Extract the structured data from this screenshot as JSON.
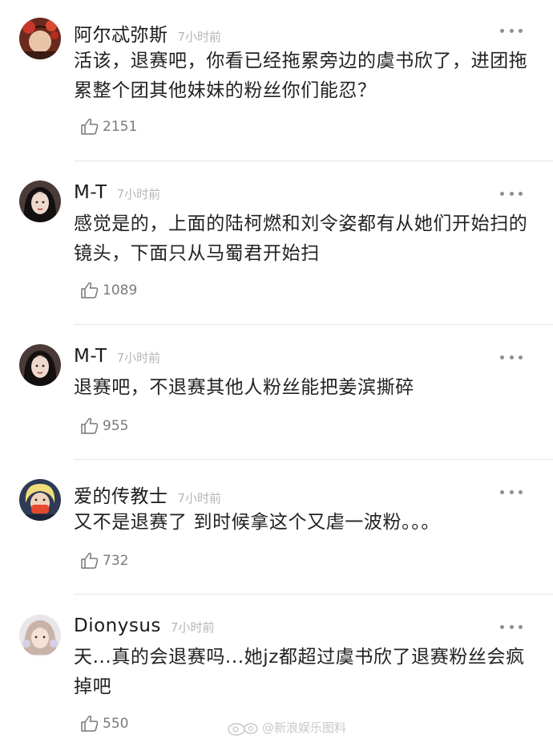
{
  "comments": [
    {
      "username": "阿尔忒弥斯",
      "time": "7小时前",
      "text": "活该，退赛吧，你看已经拖累旁边的虞书欣了，进团拖累整个团其他妹妹的粉丝你们能忍？",
      "likes": "2151",
      "avatar": "avatar-red-flower"
    },
    {
      "username": "M-T",
      "time": "7小时前",
      "text": "感觉是的，上面的陆柯燃和刘令姿都有从她们开始扫的镜头，下面只从马蜀君开始扫",
      "likes": "1089",
      "avatar": "avatar-dark-hair-woman"
    },
    {
      "username": "M-T",
      "time": "7小时前",
      "text": "退赛吧，不退赛其他人粉丝能把姜滨撕碎",
      "likes": "955",
      "avatar": "avatar-dark-hair-woman"
    },
    {
      "username": "爱的传教士",
      "time": "7小时前",
      "text": "又不是退赛了 到时候拿这个又虐一波粉。。。",
      "likes": "732",
      "avatar": "avatar-blond-masked"
    },
    {
      "username": "Dionysus",
      "time": "7小时前",
      "text": "天...真的会退赛吗...她jz都超过虞书欣了退赛粉丝会疯掉吧",
      "likes": "550",
      "avatar": "avatar-light-hair-girl"
    }
  ],
  "watermark": {
    "text": "@新浪娱乐图料",
    "icon": "weibo-logo-icon"
  },
  "icons": {
    "like": "thumbs-up-icon",
    "more": "more-dots-icon"
  },
  "colors": {
    "text": "#222222",
    "meta": "#b5b5b5",
    "divider": "#e6e6e6"
  }
}
